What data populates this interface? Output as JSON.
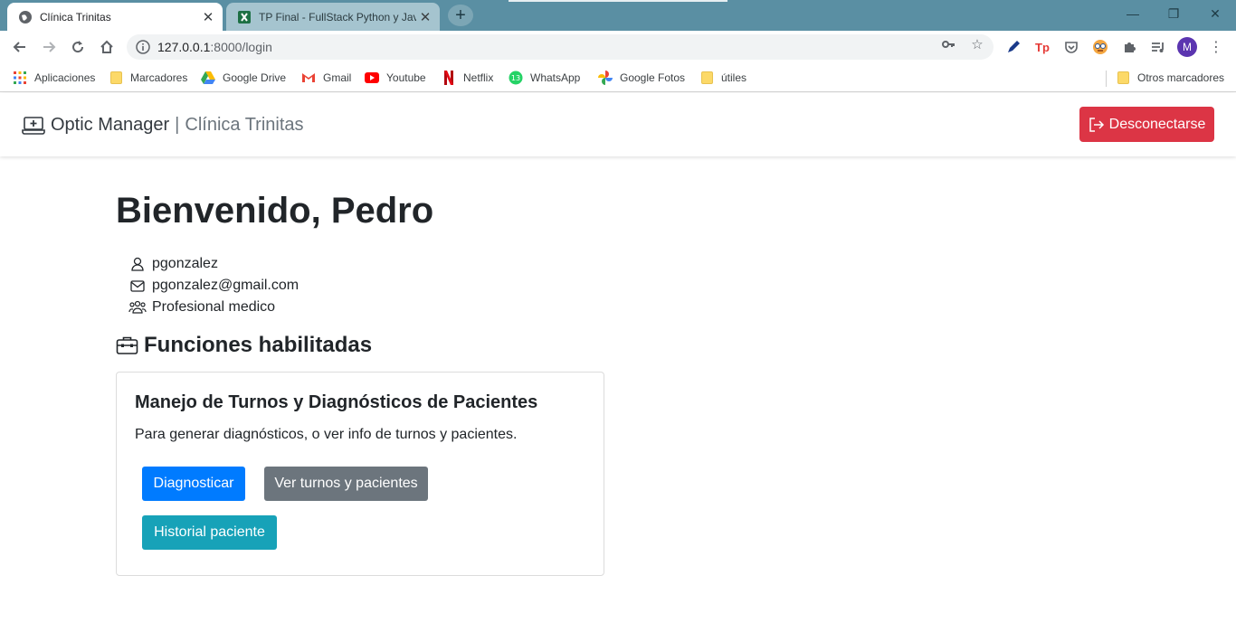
{
  "browser": {
    "tabs": [
      {
        "title": "Clínica Trinitas",
        "active": true
      },
      {
        "title": "TP Final - FullStack Python y Java",
        "active": false
      }
    ],
    "address": {
      "host": "127.0.0.1",
      "path": ":8000/login"
    },
    "bookmarks": [
      "Aplicaciones",
      "Marcadores",
      "Google Drive",
      "Gmail",
      "Youtube",
      "Netflix",
      "WhatsApp",
      "Google Fotos",
      "útiles",
      "Otros marcadores"
    ],
    "profile_initial": "M",
    "whatsapp_badge": "13"
  },
  "navbar": {
    "brand": "Optic Manager",
    "separator": "|",
    "subtitle": "Clínica Trinitas",
    "logout_label": "Desconectarse"
  },
  "user": {
    "welcome": "Bienvenido, Pedro",
    "username": "pgonzalez",
    "email": "pgonzalez@gmail.com",
    "role": "Profesional medico"
  },
  "functions": {
    "heading": "Funciones habilitadas",
    "card": {
      "title": "Manejo de Turnos y Diagnósticos de Pacientes",
      "text": "Para generar diagnósticos, o ver info de turnos y pacientes.",
      "buttons": {
        "diagnose": "Diagnosticar",
        "appointments": "Ver turnos y pacientes",
        "history": "Historial paciente"
      }
    }
  },
  "colors": {
    "danger": "#dc3545",
    "primary": "#007bff",
    "secondary": "#6c757d",
    "info": "#17a2b8",
    "tabstrip": "#5a8fa3"
  }
}
